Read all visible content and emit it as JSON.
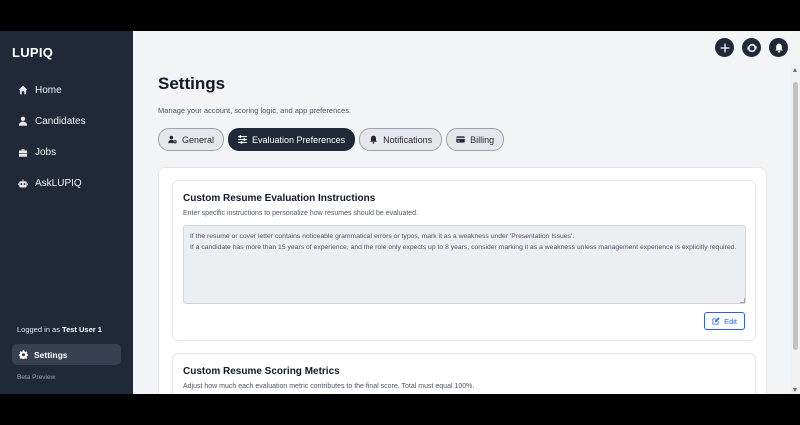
{
  "sidebar": {
    "brand": "LUPIQ",
    "items": [
      {
        "label": "Home",
        "icon": "home-icon"
      },
      {
        "label": "Candidates",
        "icon": "user-icon"
      },
      {
        "label": "Jobs",
        "icon": "briefcase-icon"
      },
      {
        "label": "AskLUPIQ",
        "icon": "robot-icon"
      }
    ],
    "logged_in_prefix": "Logged in as",
    "user_name": "Test User 1",
    "settings_label": "Settings",
    "beta_label": "Beta Preview"
  },
  "header": {
    "actions": [
      "plus-icon",
      "refresh-icon",
      "bell-icon"
    ]
  },
  "main": {
    "title": "Settings",
    "subtitle": "Manage your account, scoring logic, and app preferences.",
    "tabs": [
      {
        "label": "General",
        "icon": "user-gear-icon"
      },
      {
        "label": "Evaluation Preferences",
        "icon": "sliders-icon"
      },
      {
        "label": "Notifications",
        "icon": "bell-icon"
      },
      {
        "label": "Billing",
        "icon": "credit-card-icon"
      }
    ],
    "active_tab": "Evaluation Preferences",
    "instructions": {
      "title": "Custom Resume Evaluation Instructions",
      "description": "Enter specific instructions to personalize how resumes should be evaluated.",
      "value": "If the resume or cover letter contains noticeable grammatical errors or typos, mark it as a weakness under 'Presentation Issues'.\nIf a candidate has more than 15 years of experience, and the role only expects up to 8 years, consider marking it as a weakness unless management experience is explicitly required.",
      "edit_label": "Edit"
    },
    "metrics": {
      "title": "Custom Resume Scoring Metrics",
      "description": "Adjust how much each evaluation metric contributes to the final score. Total must equal 100%."
    }
  },
  "colors": {
    "sidebar_bg": "#1f2937",
    "accent_blue": "#2563eb",
    "page_bg": "#f3f4f6"
  }
}
